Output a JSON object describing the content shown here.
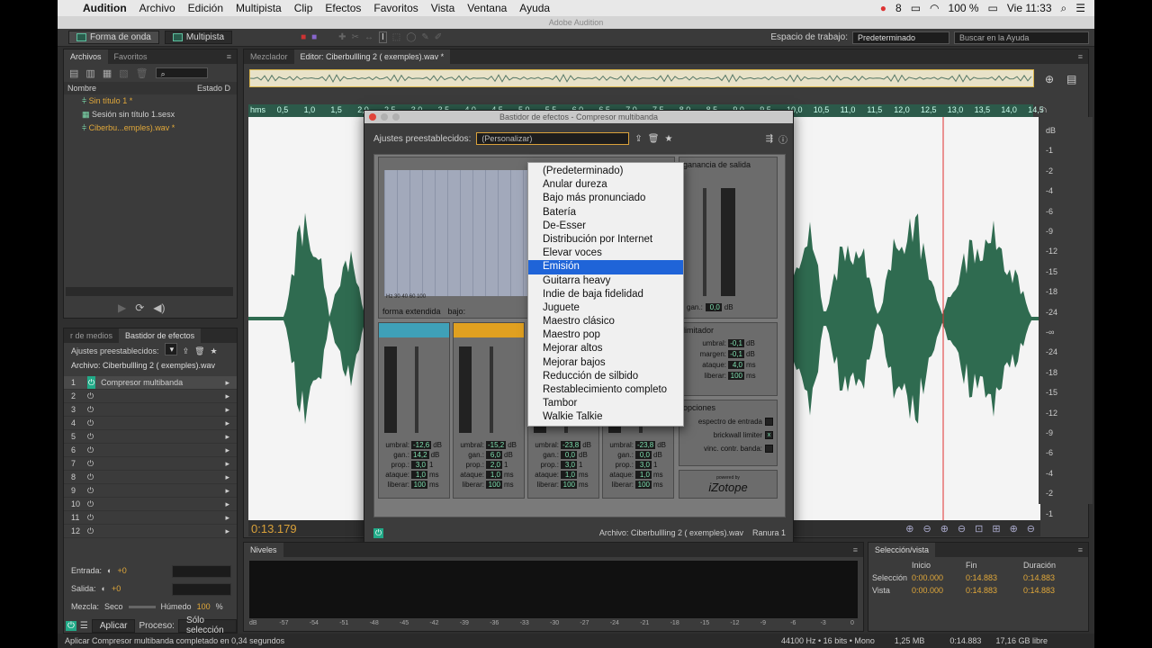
{
  "menubar": {
    "app": "Audition",
    "items": [
      "Archivo",
      "Edición",
      "Multipista",
      "Clip",
      "Efectos",
      "Favoritos",
      "Vista",
      "Ventana",
      "Ayuda"
    ],
    "right": {
      "battery": "100 %",
      "clock": "Vie 11:33",
      "num": "8"
    }
  },
  "window": {
    "title": "Adobe Audition"
  },
  "toolbar": {
    "waveform": "Forma de onda",
    "multitrack": "Multipista",
    "workspace_label": "Espacio de trabajo:",
    "workspace_value": "Predeterminado",
    "search_placeholder": "Buscar en la Ayuda"
  },
  "files": {
    "tabs": [
      "Archivos",
      "Favoritos"
    ],
    "col_name": "Nombre",
    "col_state": "Estado D",
    "items": [
      "Sin título 1 *",
      "Sesión sin título 1.sesx",
      "Ciberbu...emples).wav *"
    ]
  },
  "rackpanel": {
    "tabs": [
      "r de medios",
      "Bastidor de efectos"
    ],
    "presets_label": "Ajustes preestablecidos:",
    "file_label": "Archivo: Ciberbullling 2 ( exemples).wav",
    "slot1": "Compresor multibanda",
    "slots": [
      "1",
      "2",
      "3",
      "4",
      "5",
      "6",
      "7",
      "8",
      "9",
      "10",
      "11",
      "12"
    ],
    "input_label": "Entrada:",
    "output_label": "Salida:",
    "input_val": "+0",
    "output_val": "+0",
    "mix_label": "Mezcla:",
    "dry": "Seco",
    "wet": "Húmedo",
    "mix_val": "100",
    "mix_unit": "%",
    "apply": "Aplicar",
    "process_label": "Proceso:",
    "process_val": "Sólo selección"
  },
  "editor": {
    "tabs": [
      "Mezclador",
      "Editor: Ciberbullling 2 ( exemples).wav *"
    ],
    "time": "0:13.179",
    "ruler": [
      "hms",
      "0,5",
      "1,0",
      "1,5",
      "2,0",
      "2,5",
      "3,0",
      "3,5",
      "4,0",
      "4,5",
      "5,0",
      "5,5",
      "6,0",
      "6,5",
      "7,0",
      "7,5",
      "8,0",
      "8,5",
      "9,0",
      "9,5",
      "10,0",
      "10,5",
      "11,0",
      "11,5",
      "12,0",
      "12,5",
      "13,0",
      "13,5",
      "14,0",
      "14,5"
    ],
    "db_scale": [
      "dB",
      "-1",
      "-2",
      "-4",
      "-6",
      "-9",
      "-12",
      "-15",
      "-18",
      "-24",
      "-∞",
      "-24",
      "-18",
      "-15",
      "-12",
      "-9",
      "-6",
      "-4",
      "-2",
      "-1"
    ]
  },
  "rack": {
    "title": "Bastidor de efectos - Compresor multibanda",
    "preset_label": "Ajustes preestablecidos:",
    "preset_value": "(Personalizar)",
    "output_gain": "ganancia de salida",
    "gain_label": "gan.:",
    "gain_val": "0,0",
    "gain_unit": "dB",
    "limiter": "limitador",
    "limiter_rows": [
      {
        "l": "umbral:",
        "v": "-0,1",
        "u": "dB"
      },
      {
        "l": "margen:",
        "v": "-0,1",
        "u": "dB"
      },
      {
        "l": "ataque:",
        "v": "4,0",
        "u": "ms"
      },
      {
        "l": "liberar:",
        "v": "100",
        "u": "ms"
      }
    ],
    "options": "opciones",
    "opt_rows": [
      "espectro de entrada",
      "brickwall limiter",
      "vinc. contr. banda:"
    ],
    "brand": "iZotope",
    "brand_small": "powered by",
    "wide": "forma extendida",
    "low": "bajo:",
    "hz": "Hz",
    "freqs": [
      "Hz",
      "30",
      "40",
      "60",
      "100",
      "16000"
    ],
    "band_rows": [
      {
        "l": "umbral:",
        "u": "dB"
      },
      {
        "l": "gan.:",
        "u": "dB"
      },
      {
        "l": "prop.:",
        "u": "1"
      },
      {
        "l": "ataque:",
        "u": "ms"
      },
      {
        "l": "liberar:",
        "u": "ms"
      }
    ],
    "band_vals": [
      [
        "-12,6",
        "14,2",
        "3,0",
        "1,0",
        "100"
      ],
      [
        "-15,2",
        "6,0",
        "2,0",
        "1,0",
        "100"
      ],
      [
        "-23,8",
        "0,0",
        "3,0",
        "1,0",
        "100"
      ],
      [
        "-23,8",
        "0,0",
        "3,0",
        "1,0",
        "100"
      ]
    ],
    "file": "Archivo: Ciberbullling 2 ( exemples).wav",
    "slot": "Ranura 1"
  },
  "menu": {
    "items": [
      "(Predeterminado)",
      "Anular dureza",
      "Bajo más pronunciado",
      "Batería",
      "De-Esser",
      "Distribución por Internet",
      "Elevar voces",
      "Emisión",
      "Guitarra heavy",
      "Indie de baja fidelidad",
      "Juguete",
      "Maestro clásico",
      "Maestro pop",
      "Mejorar altos",
      "Mejorar bajos",
      "Reducción de silbido",
      "Restablecimiento completo",
      "Tambor",
      "Walkie Talkie"
    ],
    "selected": "Emisión"
  },
  "levels": {
    "tab": "Niveles",
    "scale": [
      "dB",
      "-57",
      "-54",
      "-51",
      "-48",
      "-45",
      "-42",
      "-39",
      "-36",
      "-33",
      "-30",
      "-27",
      "-24",
      "-21",
      "-18",
      "-15",
      "-12",
      "-9",
      "-6",
      "-3",
      "0"
    ]
  },
  "selection": {
    "tab": "Selección/vista",
    "start": "Inicio",
    "end": "Fin",
    "dur": "Duración",
    "sel_label": "Selección",
    "view_label": "Vista",
    "sel": [
      "0:00.000",
      "0:14.883",
      "0:14.883"
    ],
    "view": [
      "0:00.000",
      "0:14.883",
      "0:14.883"
    ]
  },
  "status": {
    "message": "Aplicar Compresor multibanda completado en 0,34 segundos",
    "format": "44100 Hz • 16 bits • Mono",
    "size": "1,25 MB",
    "duration": "0:14.883",
    "free": "17,16 GB libre"
  }
}
